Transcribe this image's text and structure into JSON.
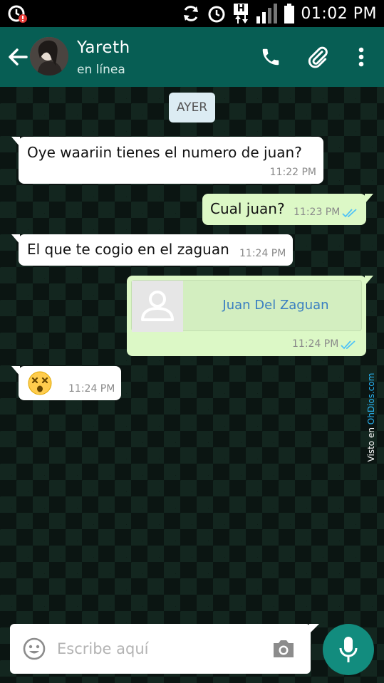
{
  "status_bar": {
    "time": "01:02 PM",
    "network_label": "H"
  },
  "header": {
    "contact_name": "Yareth",
    "contact_status": "en línea"
  },
  "chat": {
    "date_label": "AYER",
    "messages": [
      {
        "direction": "incoming",
        "text": "Oye waariin tienes el numero de juan?",
        "time": "11:22 PM"
      },
      {
        "direction": "outgoing",
        "text": "Cual juan?",
        "time": "11:23 PM",
        "read": true
      },
      {
        "direction": "incoming",
        "text": "El que te cogio en el zaguan",
        "time": "11:24 PM"
      },
      {
        "direction": "outgoing",
        "type": "contact",
        "contact_name": "Juan Del Zaguan",
        "time": "11:24 PM",
        "read": true
      },
      {
        "direction": "incoming",
        "type": "emoji",
        "emoji": "😵",
        "time": "11:24 PM"
      }
    ]
  },
  "watermark": {
    "prefix": "Visto en ",
    "brand": "OhDios.com"
  },
  "composer": {
    "placeholder": "Escribe aquí"
  },
  "colors": {
    "header": "#075e54",
    "outgoing_bubble": "#dcf8c6",
    "incoming_bubble": "#ffffff",
    "read_ticks": "#4fc3f7",
    "mic_button": "#128c7e"
  }
}
